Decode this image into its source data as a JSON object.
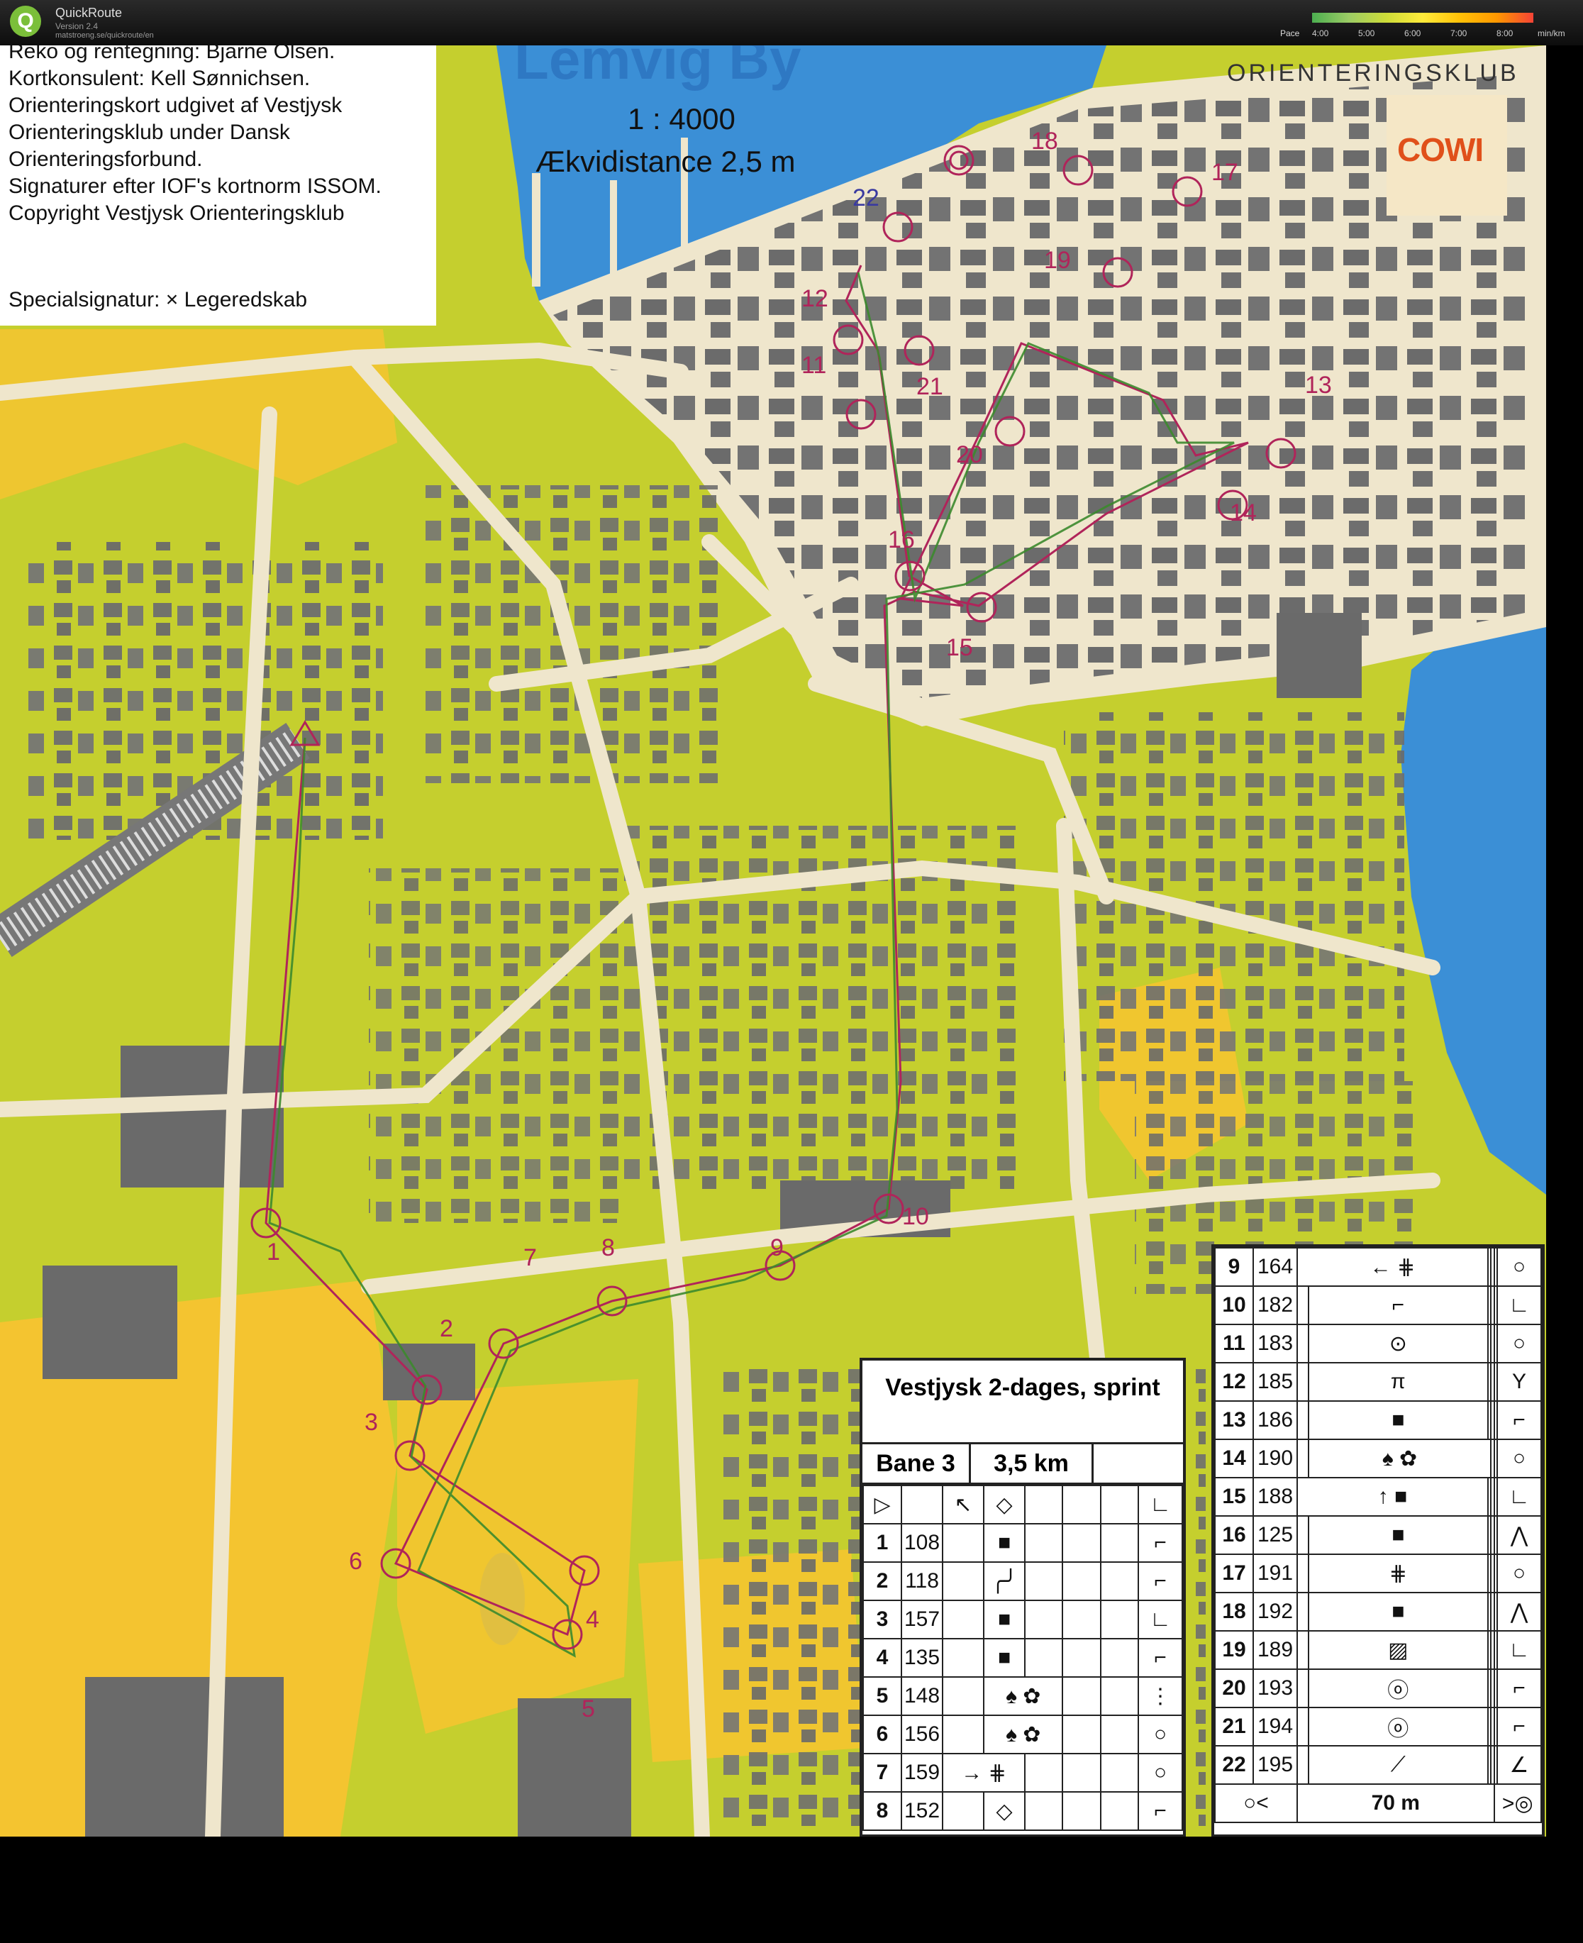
{
  "app": {
    "name": "QuickRoute",
    "version": "Version 2.4",
    "url": "matstroeng.se/quickroute/en"
  },
  "pace_scale": {
    "label": "Pace",
    "ticks": [
      "4:00",
      "5:00",
      "6:00",
      "7:00",
      "8:00"
    ],
    "unit": "min/km"
  },
  "map": {
    "title": "Lemvig By",
    "scale": "1 : 4000",
    "contour_interval": "Ækvidistance 2,5 m",
    "club_name": "ORIENTERINGSKLUB",
    "sponsor": "COWI",
    "info_lines": [
      "Reko og rentegning: Bjarne Olsen.",
      "Kortkonsulent: Kell Sønnichsen.",
      "Orienteringskort udgivet af Vestjysk",
      "Orienteringsklub under Dansk",
      "Orienteringsforbund.",
      "Signaturer efter IOF's kortnorm ISSOM.",
      "Copyright Vestjysk Orienteringsklub"
    ],
    "special_symbol": "Specialsignatur:  × Legeredskab",
    "control_labels": [
      "1",
      "2",
      "3",
      "4",
      "5",
      "6",
      "7",
      "8",
      "9",
      "10",
      "11",
      "12",
      "13",
      "14",
      "15",
      "16",
      "17",
      "18",
      "19",
      "20",
      "21",
      "22"
    ],
    "colors": {
      "water": "#3b8fd6",
      "open_land": "#f4c430",
      "vegetation": "#c8d22a",
      "buildings": "#707070",
      "paved": "#efe6cc",
      "course": "#b0245a",
      "route": "#3c8a2e"
    }
  },
  "course": {
    "event": "Vestjysk 2-dages, sprint",
    "class": "Bane 3",
    "length": "3,5 km",
    "legend_finish": "70 m",
    "controls": [
      {
        "n": "1",
        "code": "108",
        "sym": "■"
      },
      {
        "n": "2",
        "code": "118",
        "sym": "╭╯"
      },
      {
        "n": "3",
        "code": "157",
        "sym": "■"
      },
      {
        "n": "4",
        "code": "135",
        "sym": "■"
      },
      {
        "n": "5",
        "code": "148",
        "sym": "♠ ✿"
      },
      {
        "n": "6",
        "code": "156",
        "sym": "♠ ✿"
      },
      {
        "n": "7",
        "code": "159",
        "sym": "→ ⋕"
      },
      {
        "n": "8",
        "code": "152",
        "sym": "◇"
      },
      {
        "n": "9",
        "code": "164",
        "sym": "← ⋕"
      },
      {
        "n": "10",
        "code": "182",
        "sym": "⌐"
      },
      {
        "n": "11",
        "code": "183",
        "sym": "⊙"
      },
      {
        "n": "12",
        "code": "185",
        "sym": "π"
      },
      {
        "n": "13",
        "code": "186",
        "sym": "■"
      },
      {
        "n": "14",
        "code": "190",
        "sym": "♠ ✿"
      },
      {
        "n": "15",
        "code": "188",
        "sym": "↑ ■"
      },
      {
        "n": "16",
        "code": "125",
        "sym": "■"
      },
      {
        "n": "17",
        "code": "191",
        "sym": "⋕"
      },
      {
        "n": "18",
        "code": "192",
        "sym": "■"
      },
      {
        "n": "19",
        "code": "189",
        "sym": "▨"
      },
      {
        "n": "20",
        "code": "193",
        "sym": "ⓞ"
      },
      {
        "n": "21",
        "code": "194",
        "sym": "ⓞ"
      },
      {
        "n": "22",
        "code": "195",
        "sym": "⟋"
      }
    ]
  }
}
